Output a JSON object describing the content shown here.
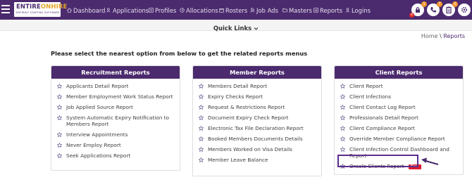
{
  "brand": {
    "logo_part1": "ENTIRE",
    "logo_part2": "ONHIRE",
    "tagline": "ENTIRELY STAFFING SOFTWARE"
  },
  "nav": {
    "items": [
      {
        "label": "Dashboard",
        "icon": "home-icon"
      },
      {
        "label": "Applications",
        "icon": "users-icon"
      },
      {
        "label": "Profiles",
        "icon": "profile-icon"
      },
      {
        "label": "Allocations",
        "icon": "clock-icon"
      },
      {
        "label": "Rosters",
        "icon": "calendar-icon"
      },
      {
        "label": "Job Ads",
        "icon": "job-icon"
      },
      {
        "label": "Masters",
        "icon": "folder-icon"
      },
      {
        "label": "Reports",
        "icon": "report-icon"
      },
      {
        "label": "Logins",
        "icon": "user-icon"
      }
    ]
  },
  "top_icons": [
    {
      "icon": "lock-icon",
      "badge": "1"
    },
    {
      "icon": "phone-icon",
      "badge": "7"
    },
    {
      "icon": "clipboard-icon",
      "badge": "0"
    },
    {
      "icon": "settings-icon",
      "badge": ""
    }
  ],
  "colors": {
    "primary": "#4b2a6e",
    "accent": "#e3a52a",
    "badge": "#f0932b",
    "new_tag": "#e0192c"
  },
  "quick_links": {
    "label": "Quick Links"
  },
  "breadcrumb": {
    "home": "Home",
    "separator": "\\",
    "current": "Reports"
  },
  "instruction": "Please select the nearest option from below to get the related reports menus",
  "cards": [
    {
      "title": "Recruitment Reports",
      "items": [
        "Applicants Detail Report",
        "Member Employment Work Status Report",
        "Job Applied Source Report",
        "System Automatic Expiry Notification to Members Report",
        "Interview Appointments",
        "Never Employ Report",
        "Seek Applications Report"
      ]
    },
    {
      "title": "Member Reports",
      "items": [
        "Members Detail Report",
        "Expiry Checks Report",
        "Request & Restrictions Report",
        "Document Expiry Check Report",
        "Electronic Tax File Declaration Report",
        "Booked Members Documents Details",
        "Members Worked on Visa Details",
        "Member Leave Balance"
      ]
    },
    {
      "title": "Client Reports",
      "items": [
        "Client Report",
        "Client Infections",
        "Client Contact Log Report",
        "Professionals Detail Report",
        "Client Compliance Report",
        "Override Member Compliance Report",
        "Client Infection Control Dashboard and Report",
        "Oracle Clients Report"
      ],
      "new_label": "New"
    }
  ]
}
